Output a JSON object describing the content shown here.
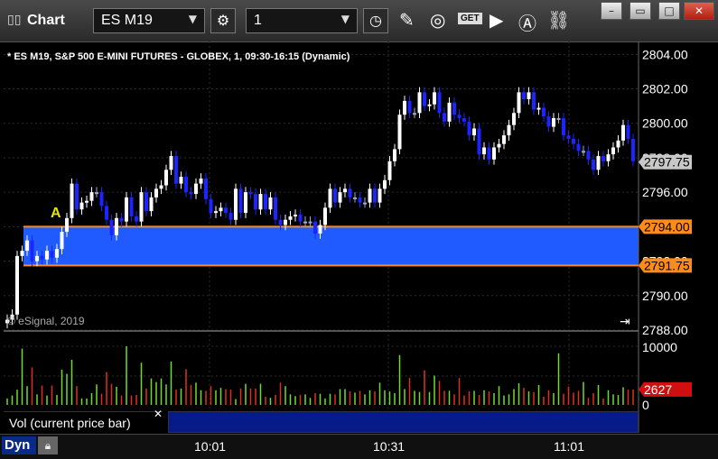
{
  "window": {
    "app_title": "Chart",
    "symbol": "ES M19",
    "interval": "1",
    "minimize": "–",
    "restore": "▭",
    "close": "✕",
    "get_label": "GET"
  },
  "chart": {
    "title": "* ES M19, S&P 500 E-MINI FUTURES - GLOBEX, 1, 09:30-16:15 (Dynamic)",
    "copyright": "© eSignal, 2019",
    "annotation": "A",
    "colors": {
      "up": "#ffffff",
      "down": "#1c24ff",
      "neutral": "#a0a8cc",
      "zone": "#1f5bff",
      "level": "#ff8c1a",
      "vol_up": "#6fdc2a",
      "vol_down": "#e0301a",
      "last": "#c8c8c8"
    },
    "price_labels": [
      "2804.00",
      "2802.00",
      "2800.00",
      "2798.00",
      "2796.00",
      "2794.00",
      "2792.00",
      "2790.00",
      "2788.00"
    ],
    "level_labels": {
      "upper": "2794.00",
      "lower": "2791.75",
      "last": "2797.75"
    },
    "volume_labels": {
      "top": "10000",
      "zero": "0",
      "last": "2627"
    },
    "time_labels": [
      "10:01",
      "10:31",
      "11:01"
    ]
  },
  "chart_data": {
    "type": "candlestick",
    "title": "* ES M19, S&P 500 E-MINI FUTURES - GLOBEX, 1, 09:30-16:15 (Dynamic)",
    "y_range": [
      2788,
      2804.75
    ],
    "volume_range": [
      0,
      10000
    ],
    "zone": {
      "upper": 2794.0,
      "lower": 2791.75
    },
    "last_price": 2797.75,
    "last_volume": 2627,
    "x_ticks": [
      "10:01",
      "10:31",
      "11:01"
    ],
    "closes": [
      2788.6,
      2788.9,
      2792.3,
      2792.6,
      2793.2,
      2792.0,
      2792.3,
      2792.1,
      2792.6,
      2792.2,
      2792.7,
      2793.7,
      2794.5,
      2796.5,
      2795.0,
      2795.4,
      2795.5,
      2796.0,
      2796.0,
      2795.2,
      2794.4,
      2793.5,
      2794.5,
      2794.3,
      2795.7,
      2794.6,
      2794.3,
      2796.0,
      2794.9,
      2795.7,
      2796.2,
      2796.4,
      2797.3,
      2798.1,
      2796.5,
      2796.9,
      2796.0,
      2795.9,
      2796.5,
      2796.8,
      2795.6,
      2794.8,
      2794.9,
      2795.1,
      2794.8,
      2794.4,
      2796.2,
      2794.8,
      2796.0,
      2795.9,
      2795.0,
      2795.9,
      2795.0,
      2795.7,
      2794.4,
      2794.1,
      2794.4,
      2794.6,
      2794.7,
      2794.3,
      2794.3,
      2794.3,
      2793.6,
      2794.1,
      2795.1,
      2796.2,
      2795.4,
      2796.0,
      2796.2,
      2795.7,
      2795.7,
      2795.4,
      2795.4,
      2796.2,
      2795.4,
      2796.2,
      2796.7,
      2797.8,
      2798.5,
      2800.5,
      2801.3,
      2800.6,
      2800.6,
      2801.8,
      2801.0,
      2801.1,
      2801.8,
      2800.6,
      2800.1,
      2801.2,
      2800.5,
      2800.3,
      2800.1,
      2799.3,
      2799.7,
      2798.2,
      2798.6,
      2797.9,
      2798.6,
      2798.8,
      2799.3,
      2799.9,
      2800.6,
      2801.8,
      2801.4,
      2801.8,
      2800.8,
      2800.9,
      2800.4,
      2799.8,
      2800.3,
      2800.3,
      2799.3,
      2799.1,
      2798.8,
      2798.4,
      2798.4,
      2797.9,
      2797.3,
      2798.1,
      2797.8,
      2798.2,
      2798.6,
      2799.0,
      2799.9,
      2799.1,
      2797.8
    ],
    "volumes": [
      1100,
      1600,
      2600,
      9600,
      3200,
      6400,
      1800,
      3300,
      1600,
      3300,
      1700,
      6000,
      5300,
      7700,
      3200,
      1100,
      1100,
      2000,
      3500,
      1900,
      5600,
      3600,
      3100,
      1600,
      10000,
      1600,
      1700,
      7200,
      2800,
      4500,
      3900,
      4500,
      3500,
      7400,
      2600,
      2800,
      6100,
      3400,
      3800,
      2500,
      2400,
      3200,
      2500,
      2900,
      2700,
      2600,
      1000,
      2800,
      3600,
      2800,
      2800,
      3600,
      1400,
      1200,
      1700,
      3800,
      3200,
      1800,
      1500,
      1700,
      1800,
      1200,
      2000,
      1900,
      1100,
      1900,
      1800,
      2700,
      2700,
      2300,
      2100,
      2400,
      1800,
      2500,
      2300,
      3800,
      2500,
      2300,
      2000,
      8500,
      2700,
      4600,
      2400,
      2200,
      5900,
      2200,
      5000,
      4100,
      2400,
      2400,
      1800,
      4600,
      1600,
      2300,
      2400,
      1700,
      2500,
      2300,
      2000,
      3200,
      1600,
      1800,
      2700,
      3700,
      2900,
      2300,
      2200,
      3400,
      1400,
      2500,
      2000,
      8800,
      1900,
      3100,
      2100,
      2400,
      3900,
      1200,
      2000,
      3400,
      1100,
      2500,
      1800,
      1700,
      3000,
      2600,
      2627
    ]
  }
}
